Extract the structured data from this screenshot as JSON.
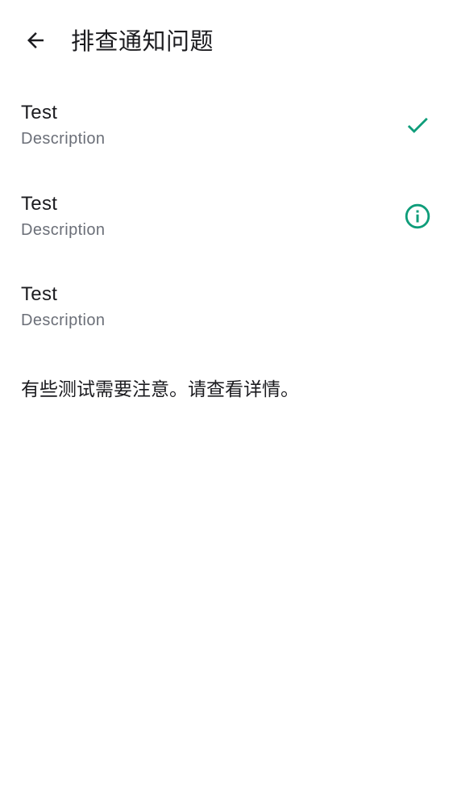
{
  "header": {
    "back_icon": "arrow-back-icon",
    "title": "排查通知问题"
  },
  "tests": [
    {
      "title": "Test",
      "description": "Description",
      "status_icon": "check-icon"
    },
    {
      "title": "Test",
      "description": "Description",
      "status_icon": "info-icon"
    },
    {
      "title": "Test",
      "description": "Description",
      "status_icon": ""
    }
  ],
  "summary": "有些测试需要注意。请查看详情。",
  "colors": {
    "accent": "#0f9d7a",
    "text_primary": "#1b1b1f",
    "text_secondary": "#6b6f78",
    "background": "#ffffff"
  }
}
